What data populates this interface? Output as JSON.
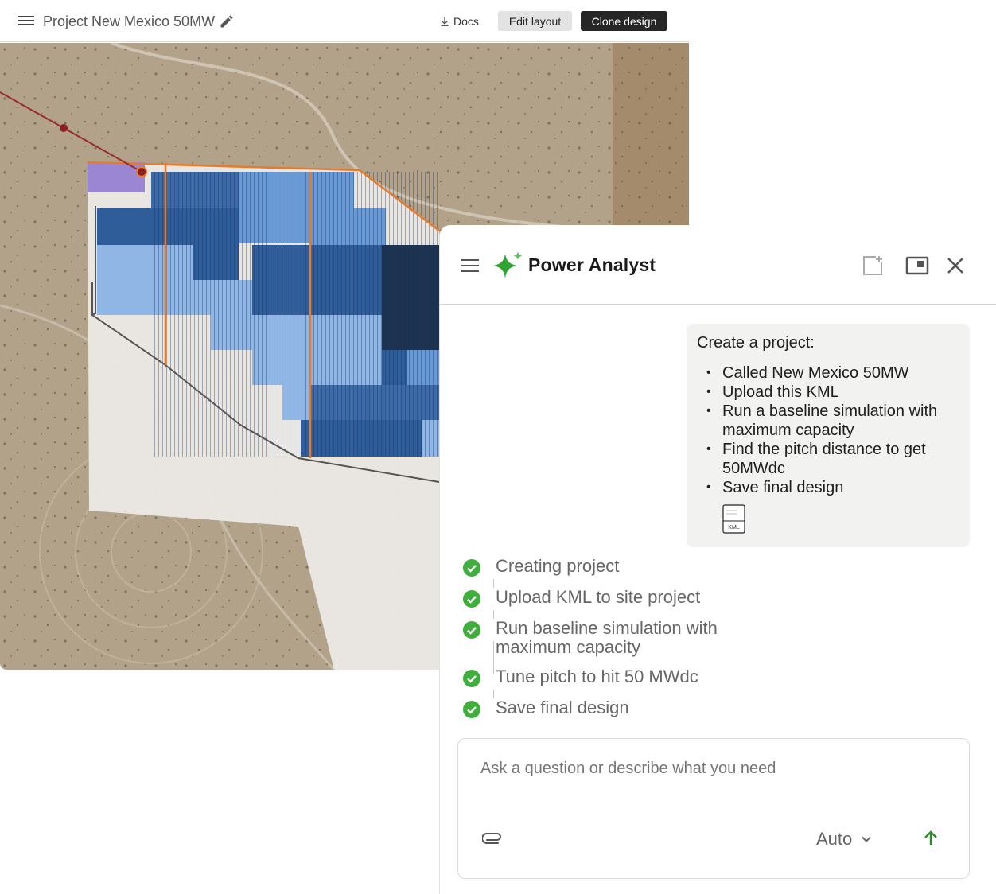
{
  "topbar": {
    "project_title": "Project New Mexico 50MW",
    "docs_label": "Docs",
    "edit_layout_label": "Edit layout",
    "clone_design_label": "Clone design"
  },
  "panel": {
    "title": "Power Analyst",
    "request": {
      "heading": "Create a project:",
      "items": [
        "Called New Mexico 50MW",
        "Upload this KML",
        "Run a baseline simulation with maximum capacity",
        "Find the pitch distance to get 50MWdc",
        "Save final design"
      ],
      "attachment_label": "KML"
    },
    "steps": [
      "Creating project",
      "Upload KML to site project",
      "Run baseline simulation with maximum capacity",
      "Tune pitch to hit 50 MWdc",
      "Save final design"
    ],
    "composer": {
      "placeholder": "Ask a question or describe what you need",
      "mode": "Auto"
    }
  },
  "colors": {
    "accent_green": "#2e9e2e",
    "check_green": "#3fae3c",
    "clone_button_bg": "#262626"
  },
  "icons": [
    "menu-icon",
    "pencil-icon",
    "download-icon",
    "sparkle-icon",
    "new-chat-icon",
    "popout-icon",
    "close-icon",
    "check-icon",
    "paperclip-icon",
    "chevron-down-icon",
    "send-arrow-icon",
    "kml-file-icon"
  ]
}
